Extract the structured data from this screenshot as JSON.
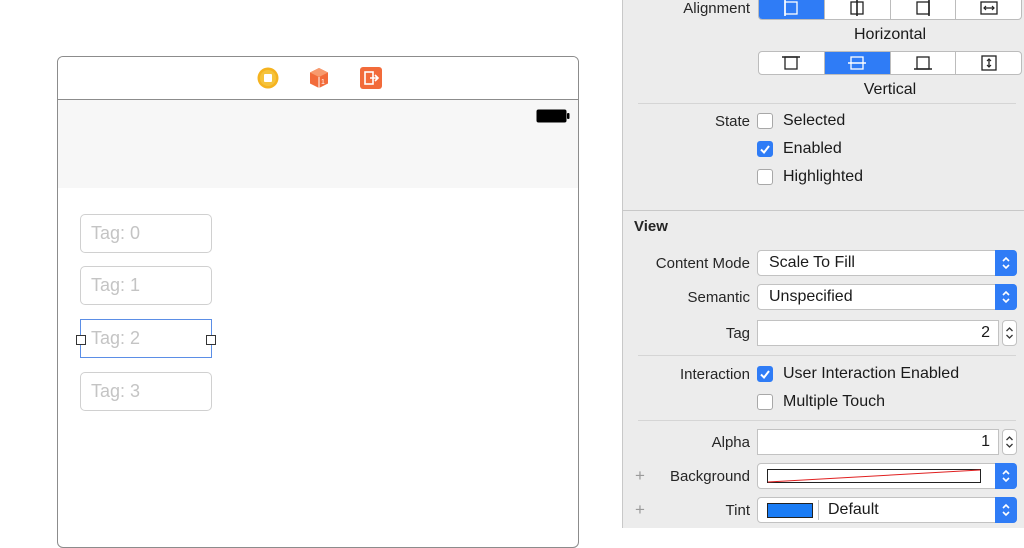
{
  "canvas": {
    "text_fields": [
      {
        "placeholder": "Tag: 0"
      },
      {
        "placeholder": "Tag: 1"
      },
      {
        "placeholder": "Tag: 2"
      },
      {
        "placeholder": "Tag: 3"
      }
    ],
    "dock_icons": [
      "view-controller-icon",
      "first-responder-cube-icon",
      "exit-icon"
    ],
    "selected_field_index": 2
  },
  "inspector": {
    "alignment_label": "Alignment",
    "horizontal_caption": "Horizontal",
    "horizontal_selected_index": 0,
    "vertical_caption": "Vertical",
    "vertical_selected_index": 1,
    "state_label": "State",
    "state_options": [
      {
        "label": "Selected",
        "checked": false
      },
      {
        "label": "Enabled",
        "checked": true
      },
      {
        "label": "Highlighted",
        "checked": false
      }
    ],
    "view_section_title": "View",
    "content_mode": {
      "label": "Content Mode",
      "value": "Scale To Fill"
    },
    "semantic": {
      "label": "Semantic",
      "value": "Unspecified"
    },
    "tag": {
      "label": "Tag",
      "value": "2"
    },
    "interaction": {
      "label": "Interaction",
      "options": [
        {
          "label": "User Interaction Enabled",
          "checked": true
        },
        {
          "label": "Multiple Touch",
          "checked": false
        }
      ]
    },
    "alpha": {
      "label": "Alpha",
      "value": "1"
    },
    "background": {
      "label": "Background"
    },
    "tint": {
      "label": "Tint",
      "value": "Default",
      "swatch_color": "#1a7cf5"
    },
    "accent_color": "#2f7cf6"
  }
}
